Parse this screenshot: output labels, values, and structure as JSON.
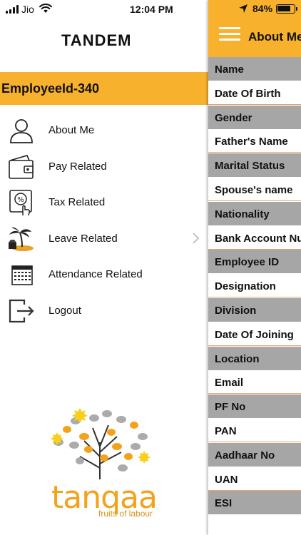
{
  "status_bar": {
    "carrier": "Jio",
    "time": "12:04 PM",
    "battery_percent": "84%",
    "battery_level": 0.84
  },
  "drawer": {
    "brand": "TANDEM",
    "employee_id": "EmployeeId-340",
    "menu": [
      {
        "label": "About Me",
        "icon": "person-icon"
      },
      {
        "label": "Pay Related",
        "icon": "wallet-icon"
      },
      {
        "label": "Tax Related",
        "icon": "tax-percent-icon"
      },
      {
        "label": "Leave Related",
        "icon": "beach-island-icon"
      },
      {
        "label": "Attendance Related",
        "icon": "calendar-icon"
      },
      {
        "label": "Logout",
        "icon": "logout-icon"
      }
    ],
    "logo": {
      "word": "tanqaa",
      "tagline": "fruits of labour"
    }
  },
  "panel": {
    "title": "About Me",
    "fields": [
      {
        "label": "Name",
        "style": "gray"
      },
      {
        "label": "Date Of Birth",
        "style": "white"
      },
      {
        "label": "Gender",
        "style": "gray"
      },
      {
        "label": "Father's Name",
        "style": "white"
      },
      {
        "label": "Marital Status",
        "style": "gray"
      },
      {
        "label": "Spouse's name",
        "style": "white"
      },
      {
        "label": "Nationality",
        "style": "gray"
      },
      {
        "label": "Bank Account Number",
        "style": "white"
      },
      {
        "label": "Employee ID",
        "style": "gray"
      },
      {
        "label": "Designation",
        "style": "white"
      },
      {
        "label": "Division",
        "style": "gray"
      },
      {
        "label": "Date Of Joining",
        "style": "white"
      },
      {
        "label": "Location",
        "style": "gray"
      },
      {
        "label": "Email",
        "style": "white"
      },
      {
        "label": "PF No",
        "style": "gray"
      },
      {
        "label": "PAN",
        "style": "white"
      },
      {
        "label": "Aadhaar No",
        "style": "gray"
      },
      {
        "label": "UAN",
        "style": "white"
      },
      {
        "label": "ESI",
        "style": "gray"
      }
    ]
  },
  "colors": {
    "accent": "#f8b12c",
    "row_gray": "#a6a6a6",
    "row_divider": "#e9a46a",
    "logo_orange": "#f4a21a"
  }
}
